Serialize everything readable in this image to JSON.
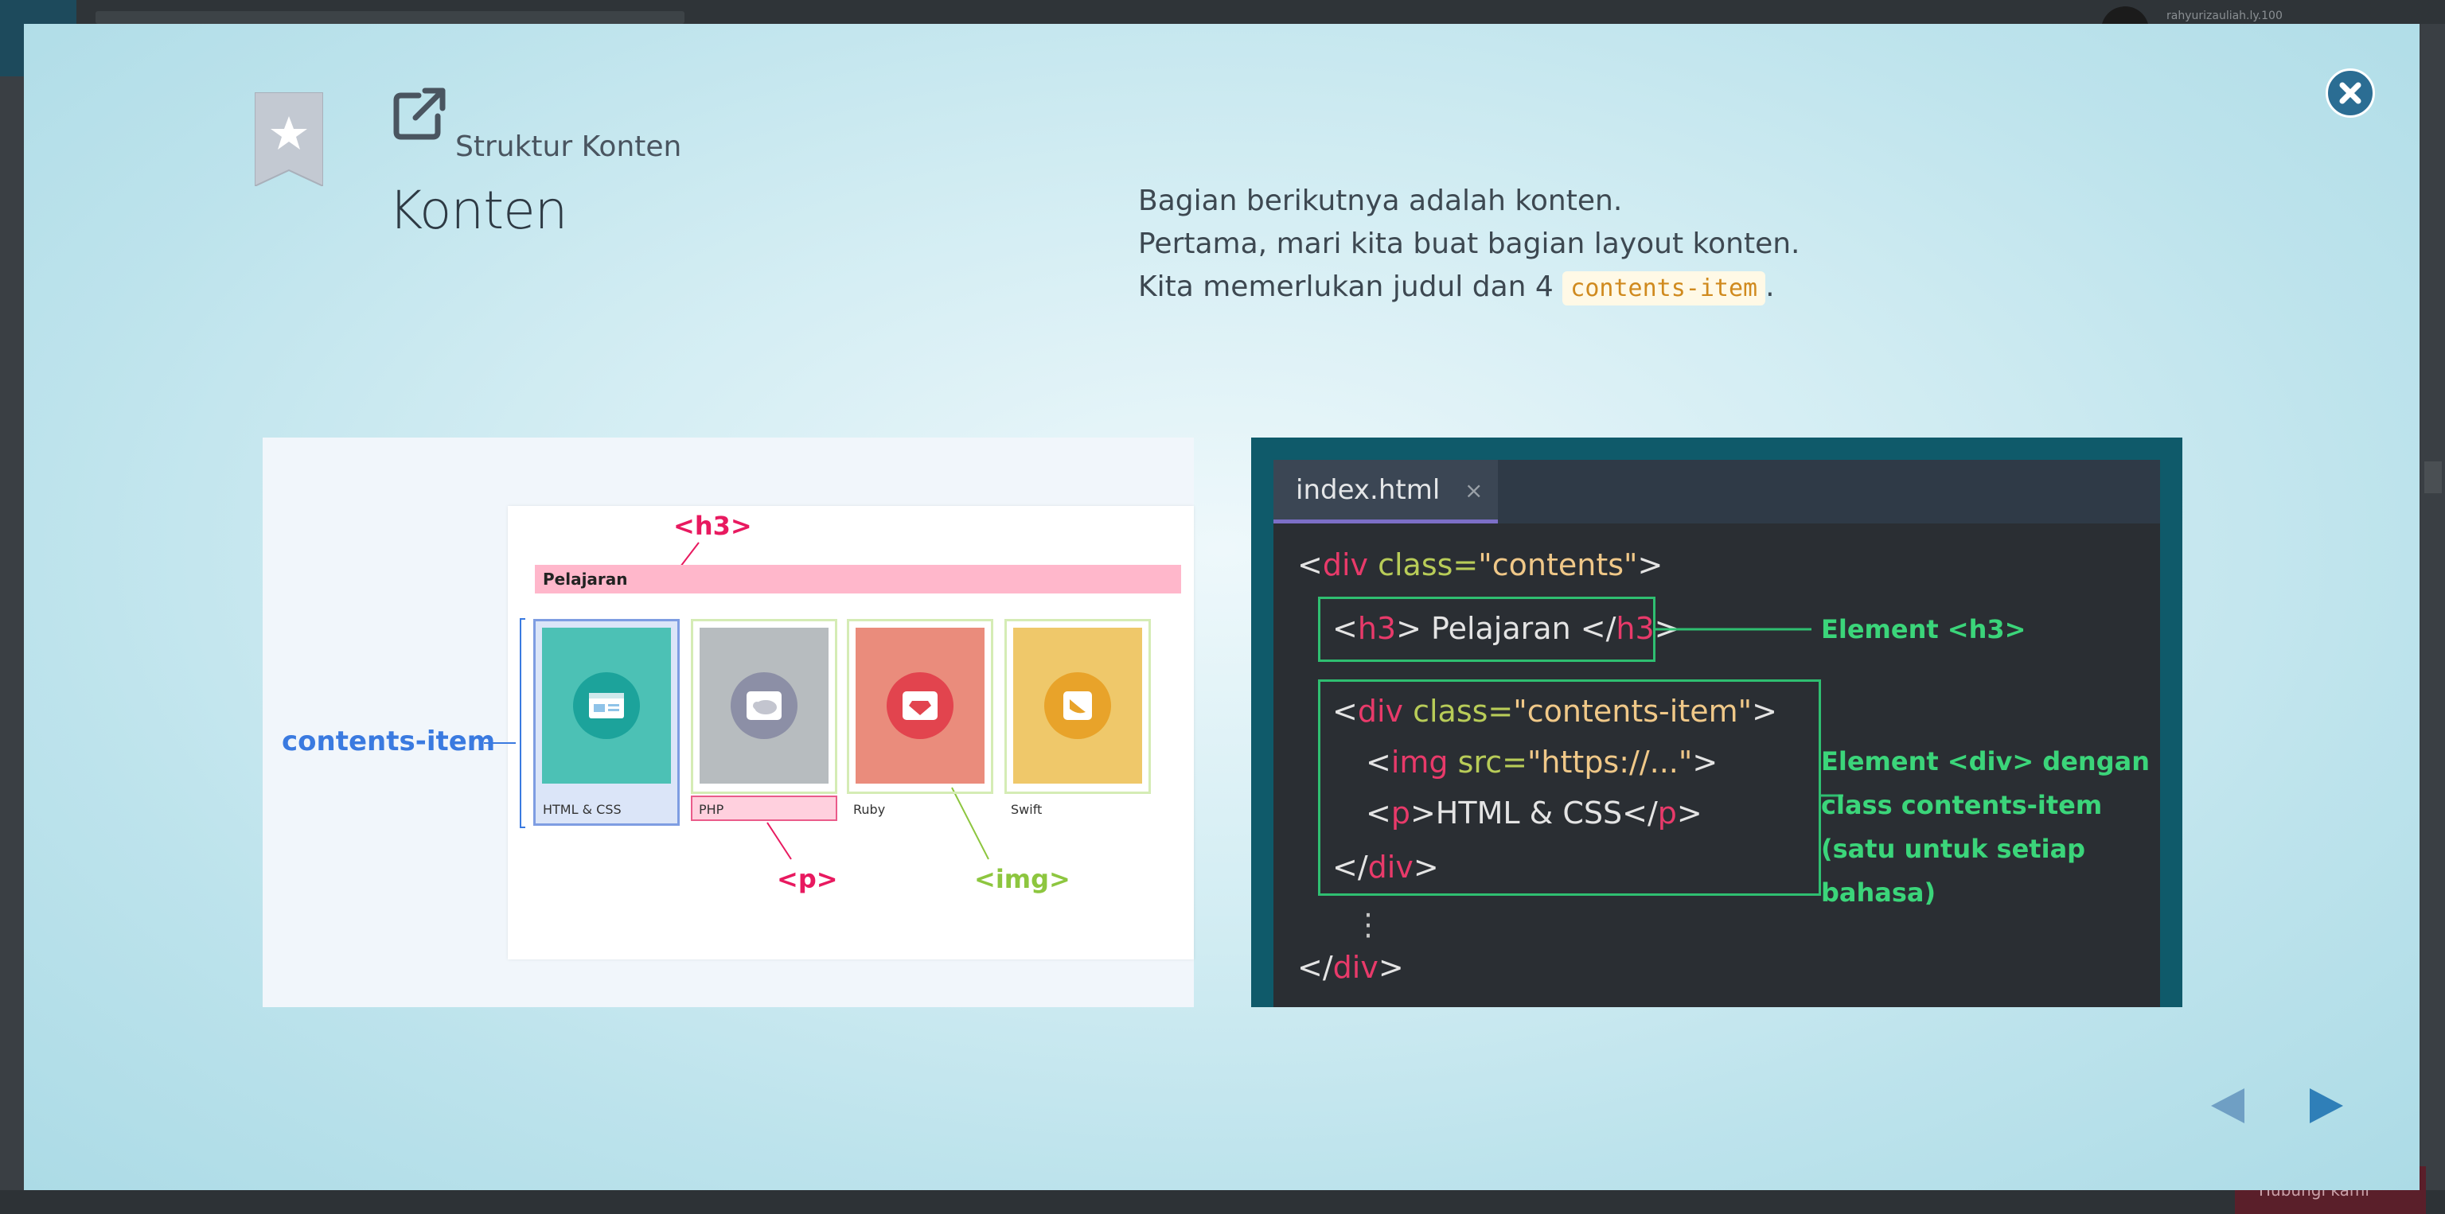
{
  "background": {
    "username": "rahyurizauliah.ly.100",
    "chat_label": "Hubungi kami"
  },
  "modal": {
    "section_label": "Struktur Konten",
    "title": "Konten",
    "description": {
      "line1": "Bagian berikutnya adalah konten.",
      "line2": "Pertama, mari kita buat bagian layout konten.",
      "line3_prefix": "Kita memerlukan judul dan 4 ",
      "line3_code": "contents-item",
      "line3_suffix": "."
    },
    "illustration": {
      "h3_tag": "<h3>",
      "heading_text": "Pelajaran",
      "contents_item_label": "contents-item",
      "p_tag": "<p>",
      "img_tag": "<img>",
      "items": [
        "HTML & CSS",
        "PHP",
        "Ruby",
        "Swift"
      ],
      "item_colors": [
        "#4cc1b5",
        "#b7bcbf",
        "#ea8c7c",
        "#efc86a"
      ]
    },
    "editor": {
      "tab_name": "index.html",
      "tab_close": "×",
      "lines": {
        "l1_open": "<",
        "l1_tag": "div",
        "l1_attr": " class=",
        "l1_val": "\"contents\"",
        "l1_close": ">",
        "l2_a": "<",
        "l2_tag": "h3",
        "l2_b": "> Pelajaran </",
        "l2_tag2": "h3",
        "l2_c": ">",
        "l3_a": "<",
        "l3_tag": "div",
        "l3_attr": " class=",
        "l3_val": "\"contents-item\"",
        "l3_c": ">",
        "l4_a": "<",
        "l4_tag": "img",
        "l4_attr": " src=",
        "l4_val": "\"https://...\"",
        "l4_c": ">",
        "l5_a": "<",
        "l5_tag": "p",
        "l5_b": ">HTML & CSS</",
        "l5_tag2": "p",
        "l5_c": ">",
        "l6_a": "</",
        "l6_tag": "div",
        "l6_c": ">",
        "l7": "⋮",
        "l8_a": "</",
        "l8_tag": "div",
        "l8_c": ">"
      },
      "note_h3": "Element <h3>",
      "note_div": [
        "Element <div> dengan",
        "class contents-item",
        "(satu untuk setiap",
        "bahasa)"
      ]
    }
  },
  "colors": {
    "accent_blue": "#2b6d93",
    "tag_pink": "#e8195f",
    "img_green": "#8dc63f",
    "note_green": "#3bd57a"
  },
  "icons": [
    "bookmark-star-icon",
    "external-link-icon",
    "close-icon",
    "prev-arrow-icon",
    "next-arrow-icon"
  ]
}
